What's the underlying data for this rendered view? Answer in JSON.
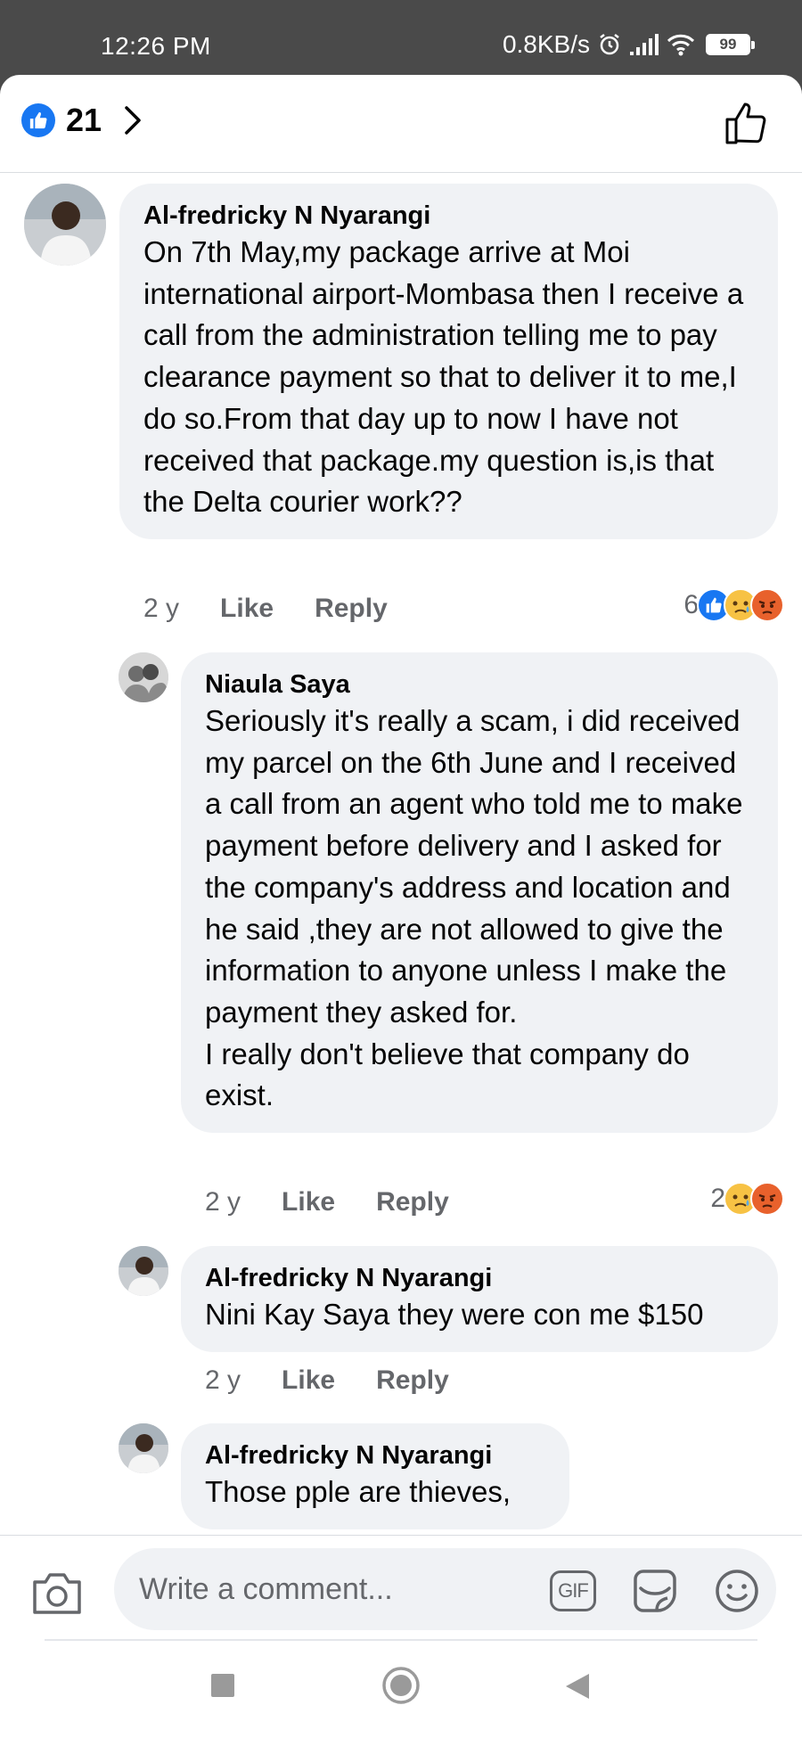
{
  "status_bar": {
    "time": "12:26 PM",
    "network_speed": "0.8KB/s",
    "battery": "99"
  },
  "header": {
    "like_count": "21"
  },
  "comments": [
    {
      "author": "Al-fredricky N Nyarangi",
      "text": "On 7th May,my package arrive at Moi international airport-Mombasa then I receive a call from the administration telling me to pay clearance payment so that to deliver it to me,I do so.From that day up to now I have not received that package.my question is,is that the Delta courier work??",
      "age": "2 y",
      "like_label": "Like",
      "reply_label": "Reply",
      "reaction_count": "6",
      "reactions": [
        "like",
        "sad",
        "angry"
      ]
    },
    {
      "author": "Niaula Saya",
      "text": "Seriously it's really a scam, i did received my parcel on the 6th June and I received a call from an agent who told me to make payment before delivery and I asked for the company's address and location and he said ,they are not allowed to give the information to anyone unless I make the payment they asked for.\nI really don't believe that company do exist.",
      "age": "2 y",
      "like_label": "Like",
      "reply_label": "Reply",
      "reaction_count": "2",
      "reactions": [
        "sad",
        "angry"
      ]
    },
    {
      "author": "Al-fredricky N Nyarangi",
      "text": "Nini Kay Saya they were con me $150",
      "age": "2 y",
      "like_label": "Like",
      "reply_label": "Reply"
    },
    {
      "author": "Al-fredricky N Nyarangi",
      "text": "Those pple are thieves,"
    }
  ],
  "composer": {
    "placeholder": "Write a comment...",
    "gif_label": "GIF"
  },
  "colors": {
    "facebook_blue": "#1877f2",
    "bubble_bg": "#f0f2f5",
    "secondary_text": "#65676b",
    "status_bar_bg": "#4a4a4a"
  }
}
